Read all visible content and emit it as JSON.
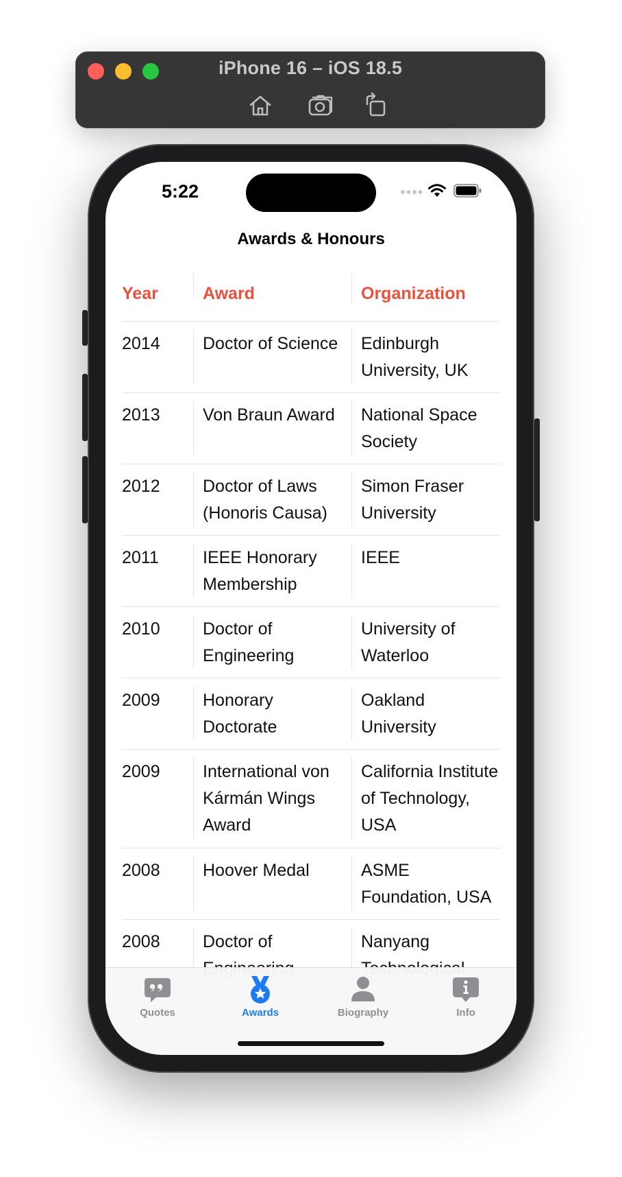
{
  "simulator": {
    "title": "iPhone 16 – iOS 18.5",
    "buttons": [
      "home-icon",
      "screenshot-icon",
      "rotate-icon"
    ]
  },
  "status_bar": {
    "time": "5:22"
  },
  "nav": {
    "title": "Awards & Honours"
  },
  "table": {
    "headers": {
      "year": "Year",
      "award": "Award",
      "organization": "Organization"
    },
    "rows": [
      {
        "year": "2014",
        "award": "Doctor of Science",
        "organization": "Edinburgh University, UK"
      },
      {
        "year": "2013",
        "award": "Von Braun Award",
        "organization": "National Space Society"
      },
      {
        "year": "2012",
        "award": "Doctor of Laws (Honoris Causa)",
        "organization": "Simon Fraser University"
      },
      {
        "year": "2011",
        "award": "IEEE Honorary Membership",
        "organization": "IEEE"
      },
      {
        "year": "2010",
        "award": "Doctor of Engineering",
        "organization": "University of Waterloo"
      },
      {
        "year": "2009",
        "award": "Honorary Doctorate",
        "organization": "Oakland University"
      },
      {
        "year": "2009",
        "award": "International von Kármán Wings Award",
        "organization": "California Institute of Technology, USA"
      },
      {
        "year": "2008",
        "award": "Hoover Medal",
        "organization": "ASME Foundation, USA"
      },
      {
        "year": "2008",
        "award": "Doctor of Engineering",
        "organization": "Nanyang Technological"
      }
    ]
  },
  "tabbar": {
    "tabs": [
      {
        "label": "Quotes",
        "icon": "quote-bubble-icon",
        "active": false
      },
      {
        "label": "Awards",
        "icon": "medal-icon",
        "active": true
      },
      {
        "label": "Biography",
        "icon": "person-icon",
        "active": false
      },
      {
        "label": "Info",
        "icon": "info-bubble-icon",
        "active": false
      }
    ]
  },
  "colors": {
    "header_accent": "#e5533d",
    "tab_active": "#1e7cf2",
    "tab_inactive": "#8e8e93"
  }
}
